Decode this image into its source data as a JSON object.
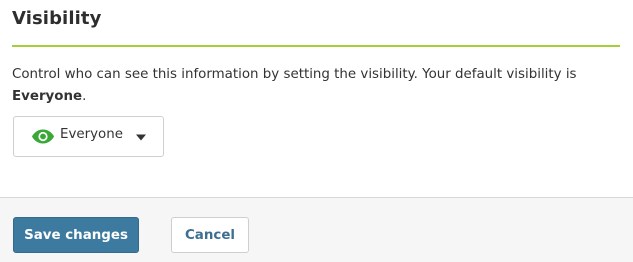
{
  "section": {
    "title": "Visibility",
    "description_prefix": "Control who can see this information by setting the visibility. Your default visibility is ",
    "description_default": "Everyone",
    "description_suffix": "."
  },
  "visibility_select": {
    "icon": "eye-icon",
    "selected": "Everyone",
    "icon_color": "#3aa836"
  },
  "footer": {
    "save_label": "Save changes",
    "cancel_label": "Cancel"
  },
  "colors": {
    "rule": "#a6ce39",
    "primary_button": "#3d7aa0",
    "cancel_text": "#3d6f90"
  }
}
